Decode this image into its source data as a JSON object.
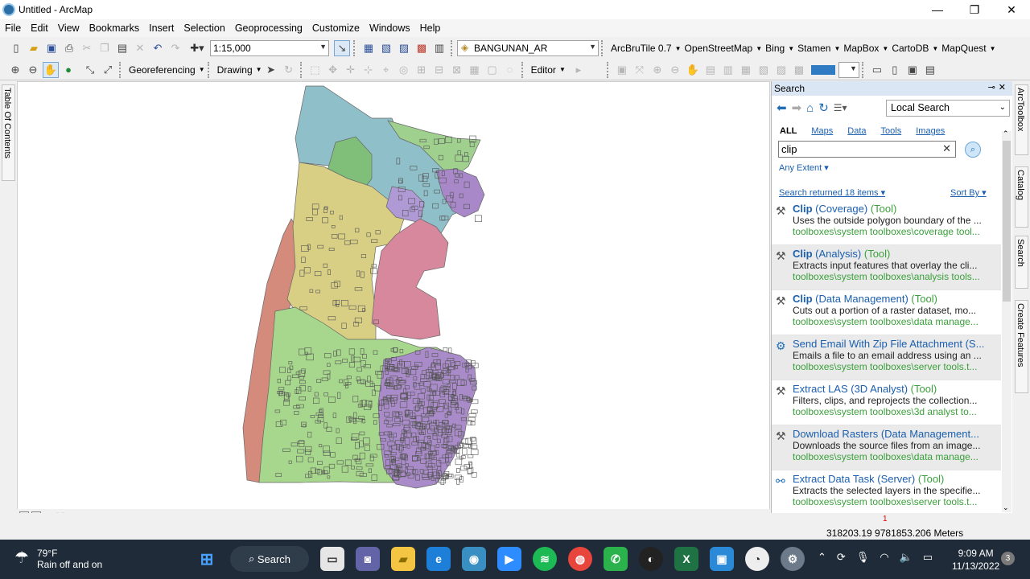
{
  "window": {
    "title": "Untitled - ArcMap",
    "controls": [
      "—",
      "❐",
      "✕"
    ]
  },
  "menu": [
    "File",
    "Edit",
    "View",
    "Bookmarks",
    "Insert",
    "Selection",
    "Geoprocessing",
    "Customize",
    "Windows",
    "Help"
  ],
  "toolbar1": {
    "scale": "1:15,000",
    "layer": "BANGUNAN_AR",
    "basemaps": [
      "ArcBruTile 0.7",
      "OpenStreetMap",
      "Bing",
      "Stamen",
      "MapBox",
      "CartoDB",
      "MapQuest"
    ]
  },
  "toolbar2": {
    "georef": "Georeferencing",
    "drawing": "Drawing",
    "editor": "Editor"
  },
  "left_tab": "Table Of Contents",
  "right_tabs": [
    "ArcToolbox",
    "Catalog",
    "Search",
    "Create Features"
  ],
  "search": {
    "header": "Search",
    "scope": "Local Search",
    "categories": [
      "ALL",
      "Maps",
      "Data",
      "Tools",
      "Images"
    ],
    "query": "clip",
    "extent": "Any Extent",
    "returned": "Search returned 18 items",
    "sort": "Sort By",
    "results": [
      {
        "name": "Clip",
        "tail": " (Coverage)",
        "kind": "(Tool)",
        "desc": "Uses the outside polygon boundary of the ...",
        "path": "toolboxes\\system toolboxes\\coverage tool..."
      },
      {
        "name": "Clip",
        "tail": " (Analysis)",
        "kind": "(Tool)",
        "desc": "Extracts input features that overlay the cli...",
        "path": "toolboxes\\system toolboxes\\analysis tools..."
      },
      {
        "name": "Clip",
        "tail": " (Data Management)",
        "kind": "(Tool)",
        "desc": "Cuts out a portion of a raster dataset, mo...",
        "path": "toolboxes\\system toolboxes\\data manage..."
      },
      {
        "name": "Send Email With Zip File Attachment (S...",
        "tail": "",
        "kind": "",
        "desc": "Emails a file to an email address using an ...",
        "path": "toolboxes\\system toolboxes\\server tools.t..."
      },
      {
        "name": "Extract LAS (3D Analyst)",
        "tail": "",
        "kind": " (Tool)",
        "desc": "Filters, clips, and reprojects the collection...",
        "path": "toolboxes\\system toolboxes\\3d analyst to..."
      },
      {
        "name": "Download Rasters (Data Management...",
        "tail": "",
        "kind": "",
        "desc": "Downloads the source files from an image...",
        "path": "toolboxes\\system toolboxes\\data manage..."
      },
      {
        "name": "Extract Data Task (Server)",
        "tail": "",
        "kind": " (Tool)",
        "desc": "Extracts the selected layers in the specifie...",
        "path": "toolboxes\\system toolboxes\\server tools.t..."
      }
    ]
  },
  "status": {
    "coords": "318203.19  9781853.206 Meters",
    "flag": "1"
  },
  "taskbar": {
    "temp": "79°F",
    "weather": "Rain off and on",
    "search": "Search",
    "time": "9:09 AM",
    "date": "11/13/2022",
    "notifications": "3"
  }
}
